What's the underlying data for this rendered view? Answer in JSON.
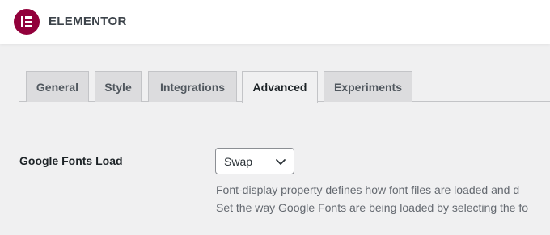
{
  "header": {
    "brand": "ELEMENTOR",
    "logo_icon": "elementor-logo-icon",
    "logo_color": "#92003b"
  },
  "tabs": [
    {
      "label": "General",
      "active": false
    },
    {
      "label": "Style",
      "active": false
    },
    {
      "label": "Integrations",
      "active": false
    },
    {
      "label": "Advanced",
      "active": true
    },
    {
      "label": "Experiments",
      "active": false
    }
  ],
  "settings": {
    "google_fonts_load": {
      "label": "Google Fonts Load",
      "selected": "Swap",
      "description_lines": [
        "Font-display property defines how font files are loaded and d",
        "Set the way Google Fonts are being loaded by selecting the fo"
      ]
    }
  }
}
